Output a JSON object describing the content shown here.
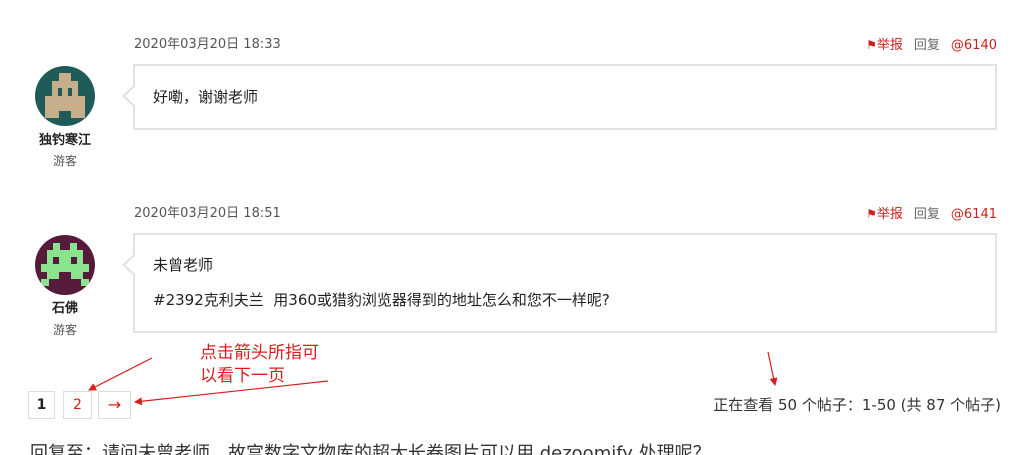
{
  "replies": [
    {
      "date": "2020年03月20日 18:33",
      "report_icon": "flag-icon",
      "report_label": "举报",
      "reply_label": "回复",
      "post_link": "@6140",
      "author": "独钓寒江",
      "role": "游客",
      "content": [
        "好嘞，谢谢老师"
      ],
      "avatar": {
        "icon": "identicon-avatar",
        "background": "#1f5c59",
        "foreground": "#c7ae8b"
      }
    },
    {
      "date": "2020年03月20日 18:51",
      "report_icon": "flag-icon",
      "report_label": "举报",
      "reply_label": "回复",
      "post_link": "@6141",
      "author": "石佛",
      "role": "游客",
      "content": [
        "未曾老师",
        "#2392克利夫兰  用360或猎豹浏览器得到的地址怎么和您不一样呢?"
      ],
      "avatar": {
        "icon": "identicon-avatar",
        "background": "#561a3a",
        "foreground": "#8ae38e"
      }
    }
  ],
  "pagination": {
    "pages": [
      {
        "label": "1",
        "current": true
      },
      {
        "label": "2",
        "current": false
      }
    ],
    "next_label": "→",
    "summary": "正在查看 50 个帖子：1-50 (共 87 个帖子)"
  },
  "annotation": {
    "lines": [
      "点击箭头所指可",
      "以看下一页"
    ],
    "color": "#d81e1e"
  },
  "reply_form": {
    "heading": "回复至：请问未曾老师，故宫数字文物库的超大长卷图片可以用 dezoomify 处理呢？"
  },
  "colors": {
    "accent": "#cc1f1a",
    "text": "#333333",
    "muted": "#666666",
    "border": "#e2e2e2"
  }
}
